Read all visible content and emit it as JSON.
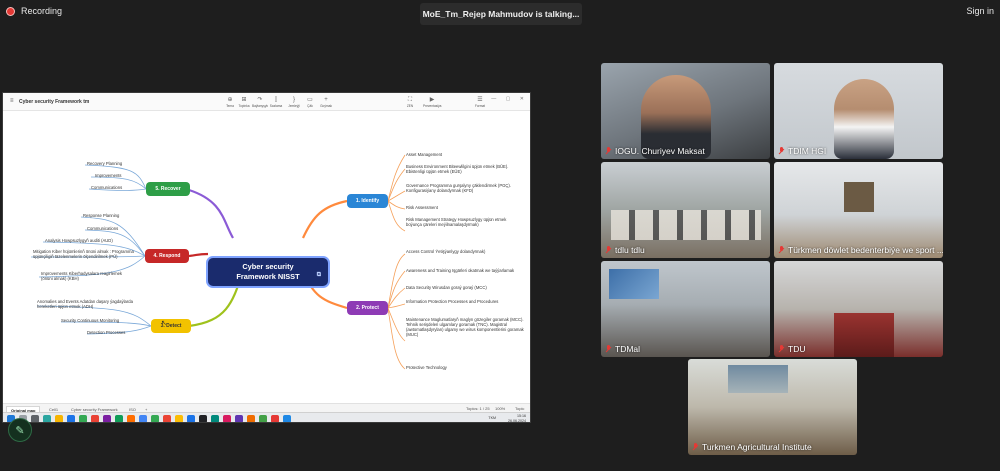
{
  "top": {
    "recording": "Recording",
    "talking": "MoE_Tm_Rejep Mahmudov is talking...",
    "signin": "Sign in"
  },
  "app": {
    "title": "Cyber security Framework tm",
    "toolbar": [
      {
        "icon": "plus-icon",
        "label": "Tema"
      },
      {
        "icon": "subtopic-icon",
        "label": "Topinka"
      },
      {
        "icon": "relation-icon",
        "label": "Baýlanyşyk"
      },
      {
        "icon": "bracket-icon",
        "label": "Sazlama"
      },
      {
        "icon": "summary-icon",
        "label": "Jemleýji"
      },
      {
        "icon": "boundary-icon",
        "label": "Çäk"
      },
      {
        "icon": "insert-icon",
        "label": "Goýmak"
      },
      {
        "icon": "zen-icon",
        "label": "ZEN"
      },
      {
        "icon": "pitch-icon",
        "label": "Prezentasiýa"
      },
      {
        "icon": "format-icon",
        "label": "Format"
      }
    ],
    "sheets": [
      "Original map",
      "Cell1",
      "Cyber security Framework",
      "ISO",
      "+"
    ],
    "status": {
      "topics": "Topics: 1 / 25",
      "zoom": "100%",
      "mode": "Topic"
    },
    "clock": {
      "time": "15:16",
      "date": "26.06.2024",
      "lang": "TKM"
    }
  },
  "mindmap": {
    "center_line1": "Cyber security",
    "center_line2": "Framework NISST",
    "branches": [
      {
        "id": "recover",
        "label": "5. Recover",
        "color": "#2e9e47",
        "items": [
          "Recovery Planning",
          "Improvements",
          "Communications"
        ]
      },
      {
        "id": "respond",
        "label": "4. Respond",
        "color": "#c62828",
        "items": [
          "Response Planning",
          "Communications",
          "Analysis  Howpsuzlygyň auditi (AUD)",
          "Mitigation  Kiber hüjümlerinň önüni almak : Programma üpjünçiligiň täzelenmelerin ölçendirilmek (PÜ)",
          "Improvements Kiberhadysalara reagirlemek (önüni almak) (KBH)"
        ]
      },
      {
        "id": "detect",
        "label": "3. Detect",
        "color": "#f2c200",
        "items": [
          "Anomalies and Events  Adatdan daşary ýagdaýlarda hereketleri üpjün etmek (ADH)",
          "Security Continuous Monitoring",
          "Detection Processes"
        ]
      },
      {
        "id": "identify",
        "label": "1. Identify",
        "color": "#2a86d6",
        "items": [
          "Asset Management",
          "Business Environment    Biteewlilgini üpjün etmek (BÜE). Ebistenligi üpjün etmek (EÜE)",
          "Governance  Programma gurşalyny çäklendirmek (PGÇ). Konfigurasiýany dolandyrmak (KFD)",
          "Risk Assessment",
          "Risk Management Strategy  Howpsuzlygy üpjün etmek boýunça çäreleri meýilnamalaşdyrmak)"
        ]
      },
      {
        "id": "protect",
        "label": "2. Protect",
        "color": "#8e3bb5",
        "items": [
          "Access Control   Ýetişýanlygy dolandyrmak)",
          "Awareness and Training   Işgärleri okatmak we taýýarlamak",
          "Data Security     Wirusdan goraý goraý (MCC)",
          "Information Protection Processes and Procedures",
          "Maintenance  Maglumatlaryň maglyn gözegiler goramak (MCC). Tehnik serişdeleri ulgamlary goramak (TNC). Magistral (awtomatlaşdyrylan) ulgamy we wirus komponentlerini goramak (MUC)",
          "Protective Technology"
        ]
      }
    ]
  },
  "participants": [
    {
      "name": "IOGU. Churiyev Maksat",
      "muted": true
    },
    {
      "name": "TDIM HGI",
      "muted": true
    },
    {
      "name": "tdlu tdlu",
      "muted": true
    },
    {
      "name": "Türkmen döwlet bedenterbiýe we sport ...",
      "muted": true
    },
    {
      "name": "TDMal",
      "muted": true
    },
    {
      "name": "TDU",
      "muted": true
    },
    {
      "name": "Turkmen Agricultural Institute",
      "muted": true
    }
  ]
}
